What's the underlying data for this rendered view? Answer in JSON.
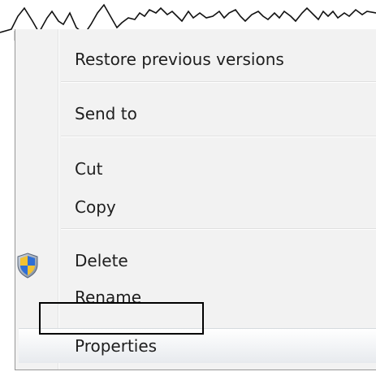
{
  "context_menu": {
    "items": [
      {
        "label": "Restore previous versions"
      },
      {
        "label": "Send to"
      },
      {
        "label": "Cut"
      },
      {
        "label": "Copy"
      },
      {
        "label": "Delete"
      },
      {
        "label": "Rename",
        "icon": "uac-shield-icon"
      },
      {
        "label": "Properties",
        "highlighted": true
      }
    ]
  }
}
